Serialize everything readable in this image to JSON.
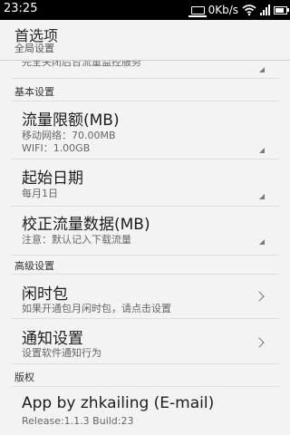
{
  "status": {
    "time": "23:25",
    "speed": "0Kb/s"
  },
  "header": {
    "title": "首选项",
    "subtitle": "全局设置"
  },
  "partial_item": {
    "summary": "完全关闭后台流量监控服务"
  },
  "sections": {
    "basic": "基本设置",
    "advanced": "高级设置",
    "copyright": "版权"
  },
  "items": {
    "limit": {
      "title": "流量限额(MB)",
      "line1": "移动网络：70.00MB",
      "line2": "WIFI：1.00GB"
    },
    "start": {
      "title": "起始日期",
      "summary": "每月1日"
    },
    "calibrate": {
      "title": "校正流量数据(MB)",
      "summary": "注意：默认记入下载流量"
    },
    "idle": {
      "title": "闲时包",
      "summary": "如果开通包月闲时包，请点击设置"
    },
    "notify": {
      "title": "通知设置",
      "summary": "设置软件通知行为"
    },
    "about": {
      "title": "App by zhkailing (E-mail)",
      "summary": "Release:1.1.3 Build:23"
    }
  },
  "icons": {
    "notification": "laptop-icon",
    "wifi": "wifi-icon",
    "signal": "signal-icon",
    "battery": "battery-icon",
    "dropdown": "dropdown-corner-icon",
    "more": "chevron-right-icon"
  }
}
